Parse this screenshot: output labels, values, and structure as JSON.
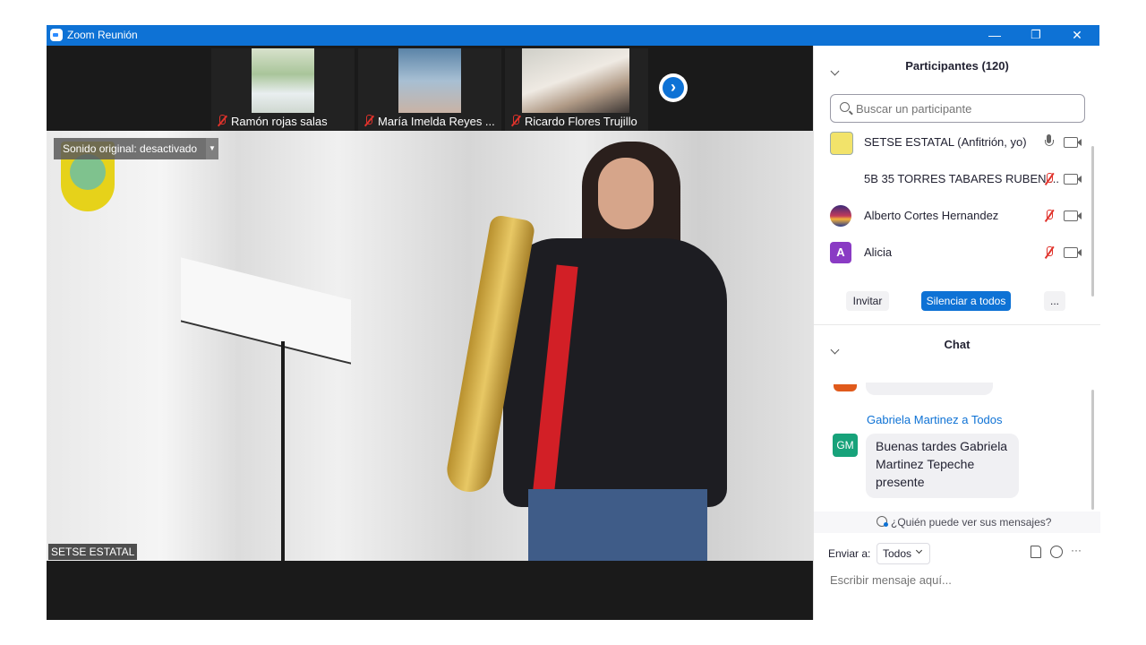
{
  "window": {
    "title": "Zoom Reunión",
    "minimize": "—",
    "restore": "❐",
    "close": "✕"
  },
  "thumbnails": [
    {
      "name": "Ramón rojas salas"
    },
    {
      "name": "María Imelda Reyes ..."
    },
    {
      "name": "Ricardo Flores Trujillo"
    }
  ],
  "main_video": {
    "original_sound": "Sonido original: desactivado",
    "speaker_name": "SETSE ESTATAL"
  },
  "participants": {
    "header": "Participantes (120)",
    "search_placeholder": "Buscar un participante",
    "list": [
      {
        "name": "SETSE ESTATAL (Anfitrión, yo)",
        "muted": false
      },
      {
        "name": "5B 35 TORRES TABARES RUBEN ...",
        "muted": true
      },
      {
        "name": "Alberto Cortes Hernandez",
        "muted": true
      },
      {
        "name": "Alicia",
        "avatar_letter": "A",
        "muted": true
      }
    ],
    "invite": "Invitar",
    "mute_all": "Silenciar a todos",
    "more": "..."
  },
  "chat": {
    "header": "Chat",
    "sender": "Gabriela Martinez a Todos",
    "sender_initials": "GM",
    "message": "Buenas tardes Gabriela Martinez Tepeche presente",
    "who_can_see": "¿Quién puede ver sus mensajes?",
    "send_to_label": "Enviar a:",
    "send_to_value": "Todos",
    "input_placeholder": "Escribir mensaje aquí...",
    "more": "···"
  },
  "colors": {
    "accent": "#0e72d5",
    "mute_red": "#e0322b",
    "gm_avatar": "#17a27a",
    "alicia_avatar": "#8a3bc4"
  }
}
